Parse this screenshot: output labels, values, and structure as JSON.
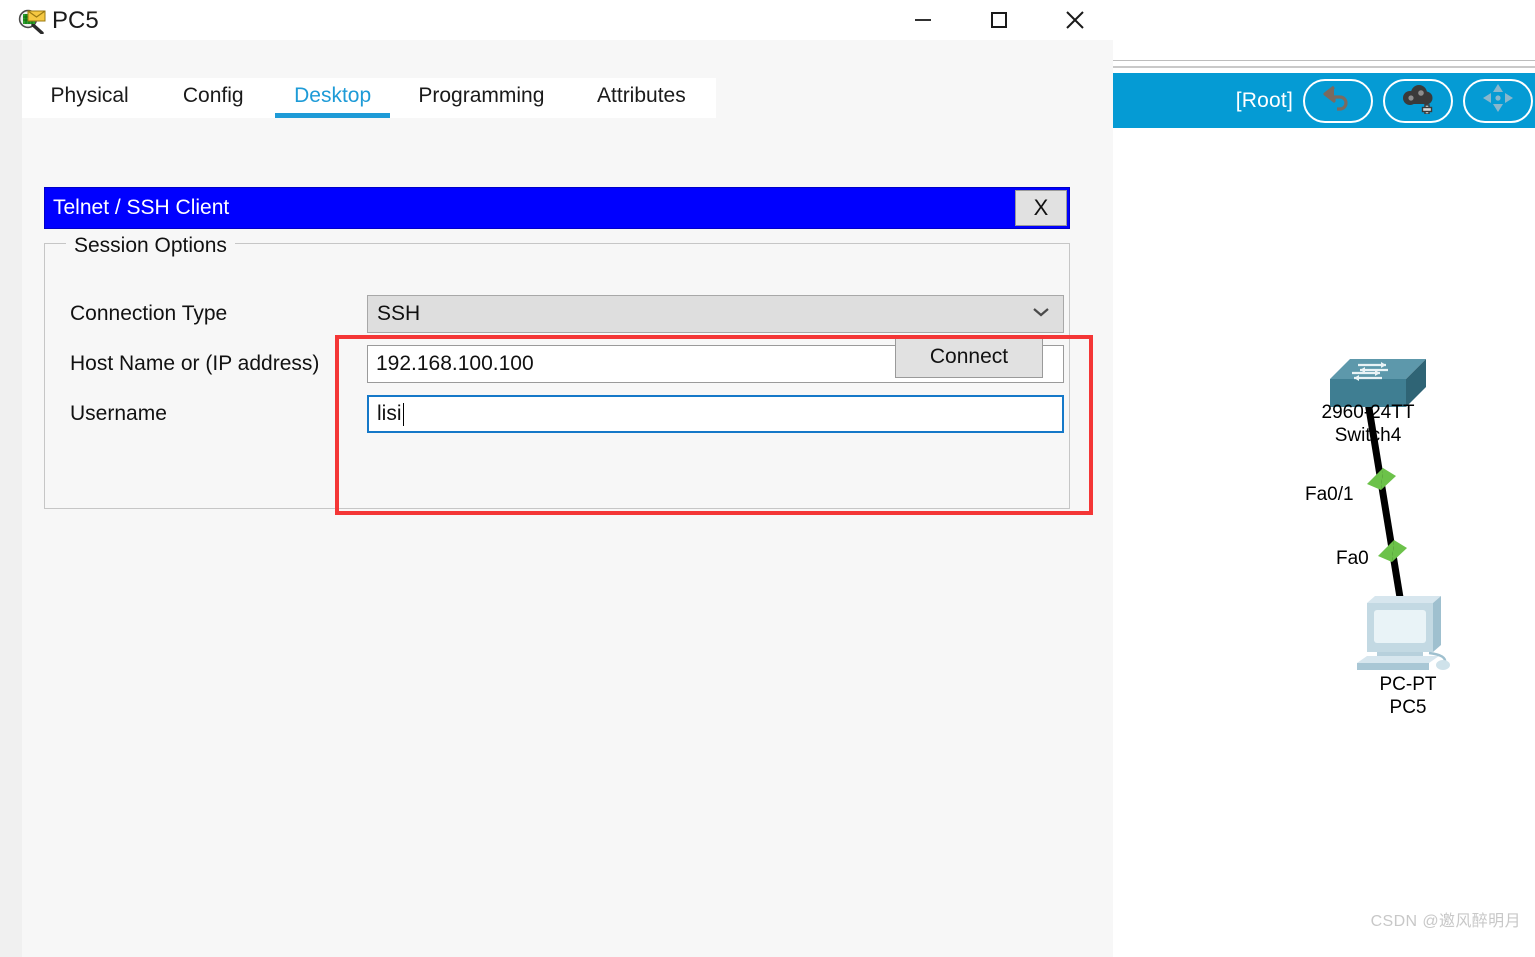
{
  "window": {
    "title": "PC5",
    "icon": "packet-inspect-icon",
    "controls": {
      "minimize": "minimize-icon",
      "maximize": "maximize-icon",
      "close": "close-icon"
    }
  },
  "tabs": [
    {
      "label": "Physical",
      "active": false
    },
    {
      "label": "Config",
      "active": false
    },
    {
      "label": "Desktop",
      "active": true
    },
    {
      "label": "Programming",
      "active": false
    },
    {
      "label": "Attributes",
      "active": false
    }
  ],
  "telnet_client": {
    "header_title": "Telnet / SSH Client",
    "close_label": "X",
    "group_legend": "Session Options",
    "fields": {
      "connection_type": {
        "label": "Connection Type",
        "value": "SSH",
        "control": "dropdown",
        "arrow_icon": "chevron-down-icon"
      },
      "host_name": {
        "label": "Host Name or (IP address)",
        "value": "192.168.100.100",
        "control": "textbox"
      },
      "username": {
        "label": "Username",
        "value": "lisi",
        "control": "textbox",
        "focused": true
      }
    },
    "connect_label": "Connect"
  },
  "packet_tracer": {
    "toolbar": {
      "root_label": "[Root]",
      "buttons": [
        {
          "name": "back-arrow-icon",
          "title": "Back"
        },
        {
          "name": "add-cluster-cloud-icon",
          "title": "New Cluster"
        },
        {
          "name": "move-object-icon",
          "title": "Move Object"
        }
      ]
    },
    "topology": {
      "devices": [
        {
          "model": "2960-24TT",
          "name": "Switch4",
          "type": "switch"
        },
        {
          "model": "PC-PT",
          "name": "PC5",
          "type": "pc"
        }
      ],
      "link": {
        "end_a_interface": "Fa0/1",
        "end_b_interface": "Fa0",
        "status": "up"
      }
    },
    "watermark": "CSDN @邀风醉明月"
  },
  "colors": {
    "accent_blue": "#1e9bd7",
    "header_blue": "#0000ff",
    "toolbar_cyan": "#059bd4",
    "annotation_red": "#f43636",
    "link_green": "#6cc24a",
    "switch_teal": "#4a8c9e"
  }
}
